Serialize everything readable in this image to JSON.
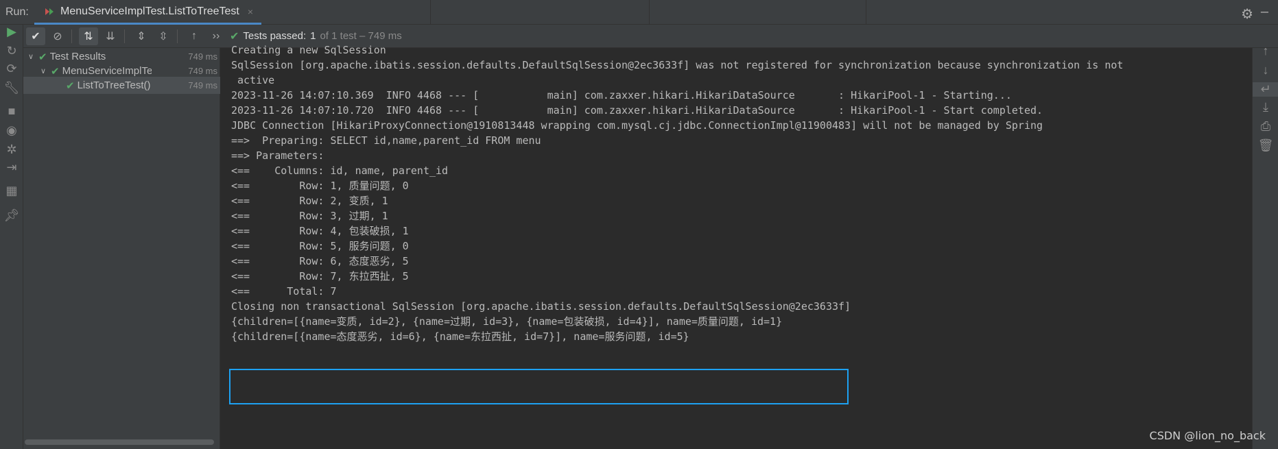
{
  "header": {
    "run_label": "Run:",
    "tab_title": "MenuServiceImplTest.ListToTreeTest",
    "tab_close": "×",
    "settings_icon": "gear-icon",
    "minimize_icon": "minimize-icon"
  },
  "toolbar": {
    "tests_passed_label": "Tests passed:",
    "tests_passed_count": "1",
    "tests_passed_rest": "of 1 test – 749 ms",
    "more": "››"
  },
  "tree": {
    "items": [
      {
        "label": "Test Results",
        "time": "749 ms"
      },
      {
        "label": "MenuServiceImplTest",
        "time": "749 ms"
      },
      {
        "label": "ListToTreeTest()",
        "time": "749 ms"
      }
    ]
  },
  "console": {
    "lines": [
      "Creating a new SqlSession",
      "SqlSession [org.apache.ibatis.session.defaults.DefaultSqlSession@2ec3633f] was not registered for synchronization because synchronization is not",
      " active",
      "2023-11-26 14:07:10.369  INFO 4468 --- [           main] com.zaxxer.hikari.HikariDataSource       : HikariPool-1 - Starting...",
      "2023-11-26 14:07:10.720  INFO 4468 --- [           main] com.zaxxer.hikari.HikariDataSource       : HikariPool-1 - Start completed.",
      "JDBC Connection [HikariProxyConnection@1910813448 wrapping com.mysql.cj.jdbc.ConnectionImpl@11900483] will not be managed by Spring",
      "==>  Preparing: SELECT id,name,parent_id FROM menu",
      "==> Parameters: ",
      "<==    Columns: id, name, parent_id",
      "<==        Row: 1, 质量问题, 0",
      "<==        Row: 2, 变质, 1",
      "<==        Row: 3, 过期, 1",
      "<==        Row: 4, 包装破损, 1",
      "<==        Row: 5, 服务问题, 0",
      "<==        Row: 6, 态度恶劣, 5",
      "<==        Row: 7, 东拉西扯, 5",
      "<==      Total: 7",
      "Closing non transactional SqlSession [org.apache.ibatis.session.defaults.DefaultSqlSession@2ec3633f]",
      "{children=[{name=变质, id=2}, {name=过期, id=3}, {name=包装破损, id=4}], name=质量问题, id=1}",
      "{children=[{name=态度恶劣, id=6}, {name=东拉西扯, id=7}], name=服务问题, id=5}"
    ]
  },
  "watermark": "CSDN @lion_no_back",
  "colors": {
    "accent": "#4a88c7",
    "success": "#59a869",
    "highlight": "#1da1f2",
    "background": "#2b2b2b",
    "panel": "#3c3f41"
  }
}
